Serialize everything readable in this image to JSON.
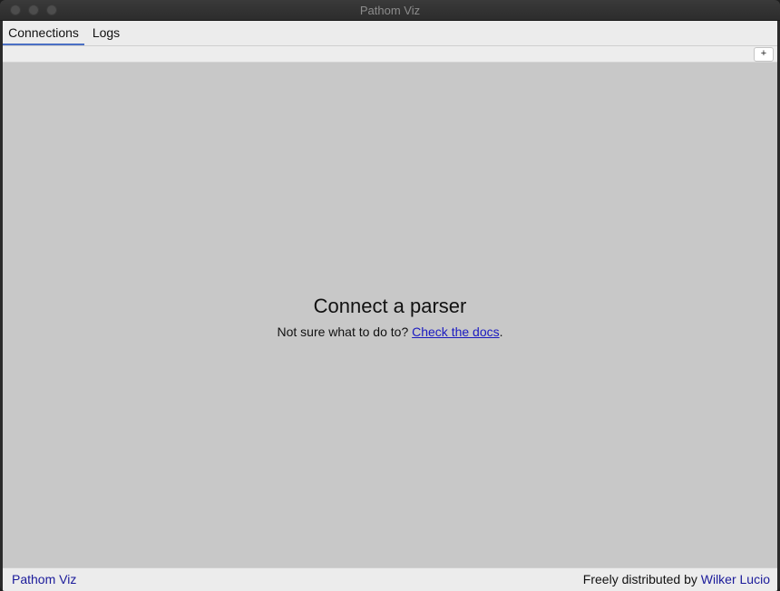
{
  "window": {
    "title": "Pathom Viz"
  },
  "tabs": [
    {
      "label": "Connections",
      "active": true
    },
    {
      "label": "Logs",
      "active": false
    }
  ],
  "toolbar": {
    "add_label": "+"
  },
  "main": {
    "heading": "Connect a parser",
    "prompt": "Not sure what to do to? ",
    "docs_link": "Check the docs",
    "prompt_end": "."
  },
  "footer": {
    "app_link": "Pathom Viz",
    "credit_text": "Freely distributed by ",
    "author_link": "Wilker Lucio"
  },
  "colors": {
    "accent": "#4a6fc4",
    "link": "#1a1ac0",
    "main_bg": "#c8c8c8"
  }
}
